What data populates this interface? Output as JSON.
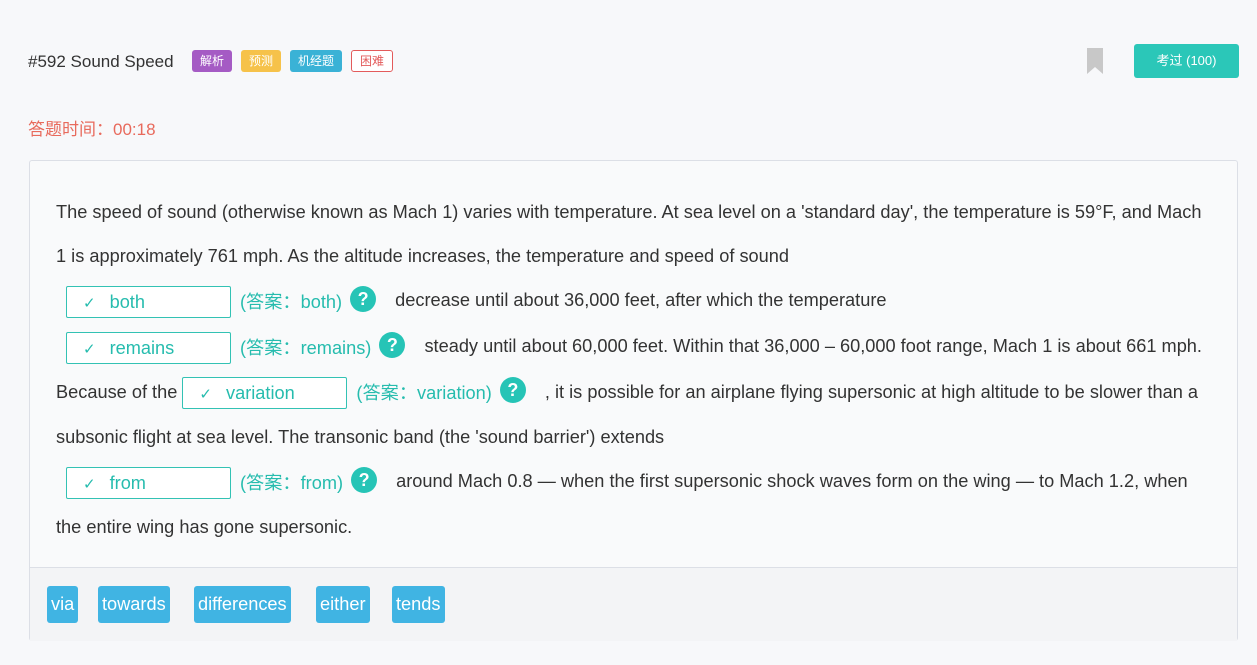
{
  "header": {
    "title": "#592 Sound Speed",
    "tags": [
      "解析",
      "预测",
      "机经题",
      "困难"
    ],
    "pass_button": "考过 (100)"
  },
  "timer": "答题时间：00:18",
  "passage": {
    "p1": "The speed of sound (otherwise known as Mach 1) varies with temperature. At sea level on a 'standard day', the temperature is 59°F, and Mach 1 is approximately 761 mph. As the altitude increases, the temperature and speed of sound",
    "p2": "decrease until about 36,000 feet, after which the temperature",
    "p3": "steady until about 60,000 feet. Within that 36,000 – 60,000 foot range, Mach 1 is about 661 mph. Because of the",
    "p4": ", it is possible for an airplane flying supersonic at high altitude to be slower than a subsonic flight at sea level. The transonic band (the 'sound barrier') extends",
    "p5": "around Mach 0.8 — when the first supersonic shock waves form on the wing — to Mach 1.2, when the entire wing has gone supersonic."
  },
  "blanks": [
    {
      "value": "both",
      "answer": "(答案：both)"
    },
    {
      "value": "remains",
      "answer": "(答案：remains)"
    },
    {
      "value": "variation",
      "answer": "(答案：variation)"
    },
    {
      "value": "from",
      "answer": "(答案：from)"
    }
  ],
  "icons": {
    "check": "✓",
    "help": "?"
  },
  "word_bank": [
    "via",
    "towards",
    "differences",
    "either",
    "tends"
  ],
  "colors": {
    "accent": "#2bc7b8",
    "timer": "#e86a5c",
    "word_chip": "#40b4e3"
  }
}
